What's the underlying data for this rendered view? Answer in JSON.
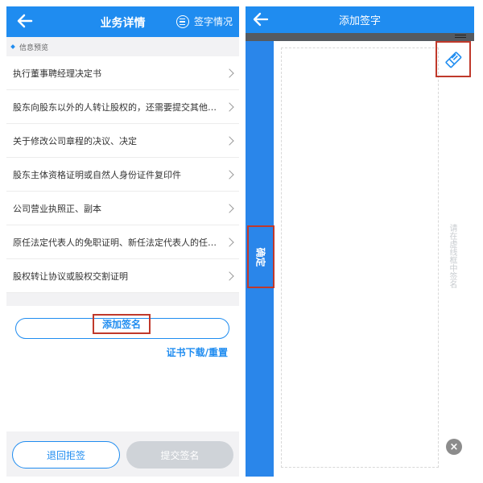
{
  "left": {
    "header": {
      "title": "业务详情",
      "sign_status": "签字情况"
    },
    "section_label": "信息预览",
    "items": [
      {
        "label": "执行董事聘经理决定书"
      },
      {
        "label": "股东向股东以外的人转让股权的，还需要提交其他…"
      },
      {
        "label": "关于修改公司章程的决议、决定"
      },
      {
        "label": "股东主体资格证明或自然人身份证件复印件"
      },
      {
        "label": "公司营业执照正、副本"
      },
      {
        "label": "原任法定代表人的免职证明、新任法定代表人的任…"
      },
      {
        "label": "股权转让协议或股权交割证明"
      }
    ],
    "add_sign": "添加签名",
    "cert_link": "证书下载/重置",
    "buttons": {
      "reject": "退回拒签",
      "submit": "提交签名"
    }
  },
  "right": {
    "header": {
      "title": "添加签字"
    },
    "confirm": "确定",
    "hint": "请在虚线框中签名",
    "close_symbol": "×"
  },
  "colors": {
    "primary": "#1f8cf0",
    "highlight": "#c0392b",
    "disabled": "#cfd3d8"
  },
  "icons": [
    "back-arrow-icon",
    "list-icon",
    "chevron-right-icon",
    "eraser-icon",
    "close-icon"
  ]
}
